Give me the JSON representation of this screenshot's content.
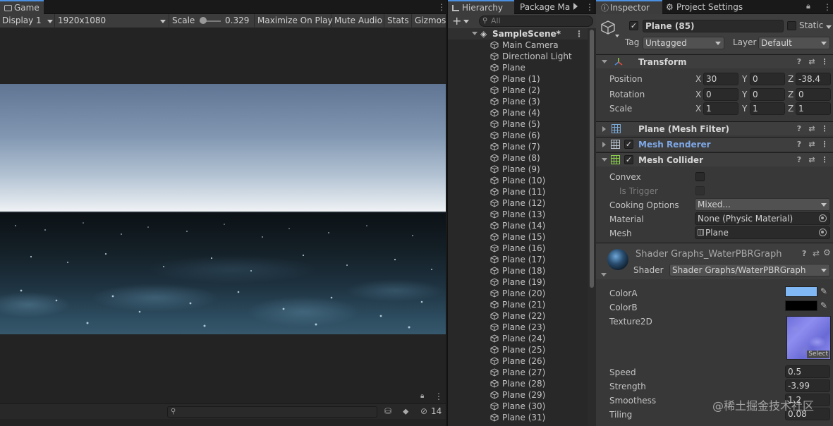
{
  "game": {
    "tab": "Game",
    "display": "Display 1",
    "resolution": "1920x1080",
    "scale_label": "Scale",
    "scale_value": "0.329",
    "maximize": "Maximize On Play",
    "mute": "Mute Audio",
    "stats": "Stats",
    "gizmos": "Gizmos",
    "hidden_count": "14"
  },
  "hierarchy": {
    "tab": "Hierarchy",
    "tab2": "Package Ma",
    "search_placeholder": "All",
    "scene": "SampleScene*",
    "items": [
      "Main Camera",
      "Directional Light",
      "Plane",
      "Plane (1)",
      "Plane (2)",
      "Plane (3)",
      "Plane (4)",
      "Plane (5)",
      "Plane (6)",
      "Plane (7)",
      "Plane (8)",
      "Plane (9)",
      "Plane (10)",
      "Plane (11)",
      "Plane (12)",
      "Plane (13)",
      "Plane (14)",
      "Plane (15)",
      "Plane (16)",
      "Plane (17)",
      "Plane (18)",
      "Plane (19)",
      "Plane (20)",
      "Plane (21)",
      "Plane (22)",
      "Plane (23)",
      "Plane (24)",
      "Plane (25)",
      "Plane (26)",
      "Plane (27)",
      "Plane (28)",
      "Plane (29)",
      "Plane (30)",
      "Plane (31)"
    ]
  },
  "inspector": {
    "tab": "Inspector",
    "tab2": "Project Settings",
    "object_name": "Plane (85)",
    "static": "Static",
    "tag_label": "Tag",
    "tag_value": "Untagged",
    "layer_label": "Layer",
    "layer_value": "Default",
    "transform": {
      "title": "Transform",
      "position_label": "Position",
      "rotation_label": "Rotation",
      "scale_label": "Scale",
      "position": [
        "30",
        "0",
        "-38.4"
      ],
      "rotation": [
        "0",
        "0",
        "0"
      ],
      "scale": [
        "1",
        "1",
        "1"
      ]
    },
    "mesh_filter": "Plane (Mesh Filter)",
    "mesh_renderer": "Mesh Renderer",
    "mesh_collider": {
      "title": "Mesh Collider",
      "convex": "Convex",
      "is_trigger": "Is Trigger",
      "cooking_label": "Cooking Options",
      "cooking_value": "Mixed...",
      "material_label": "Material",
      "material_value": "None (Physic Material)",
      "mesh_label": "Mesh",
      "mesh_value": "Plane"
    },
    "material": {
      "name": "Shader Graphs_WaterPBRGraph",
      "shader_label": "Shader",
      "shader_value": "Shader Graphs/WaterPBRGraph",
      "colorA_label": "ColorA",
      "colorA": "#7fb8f5",
      "colorB_label": "ColorB",
      "colorB": "#000000",
      "texture_label": "Texture2D",
      "select": "Select",
      "speed_label": "Speed",
      "speed": "0.5",
      "strength_label": "Strength",
      "strength": "-3.99",
      "smoothness_label": "Smoothess",
      "smoothness": "1.2",
      "tiling_label": "Tiling",
      "tiling": "0.08"
    }
  },
  "watermark": "@稀土掘金技术社区",
  "axes": {
    "x": "X",
    "y": "Y",
    "z": "Z"
  },
  "colors": {
    "accent": "#4a8fe0",
    "link": "#7ea7e6"
  }
}
